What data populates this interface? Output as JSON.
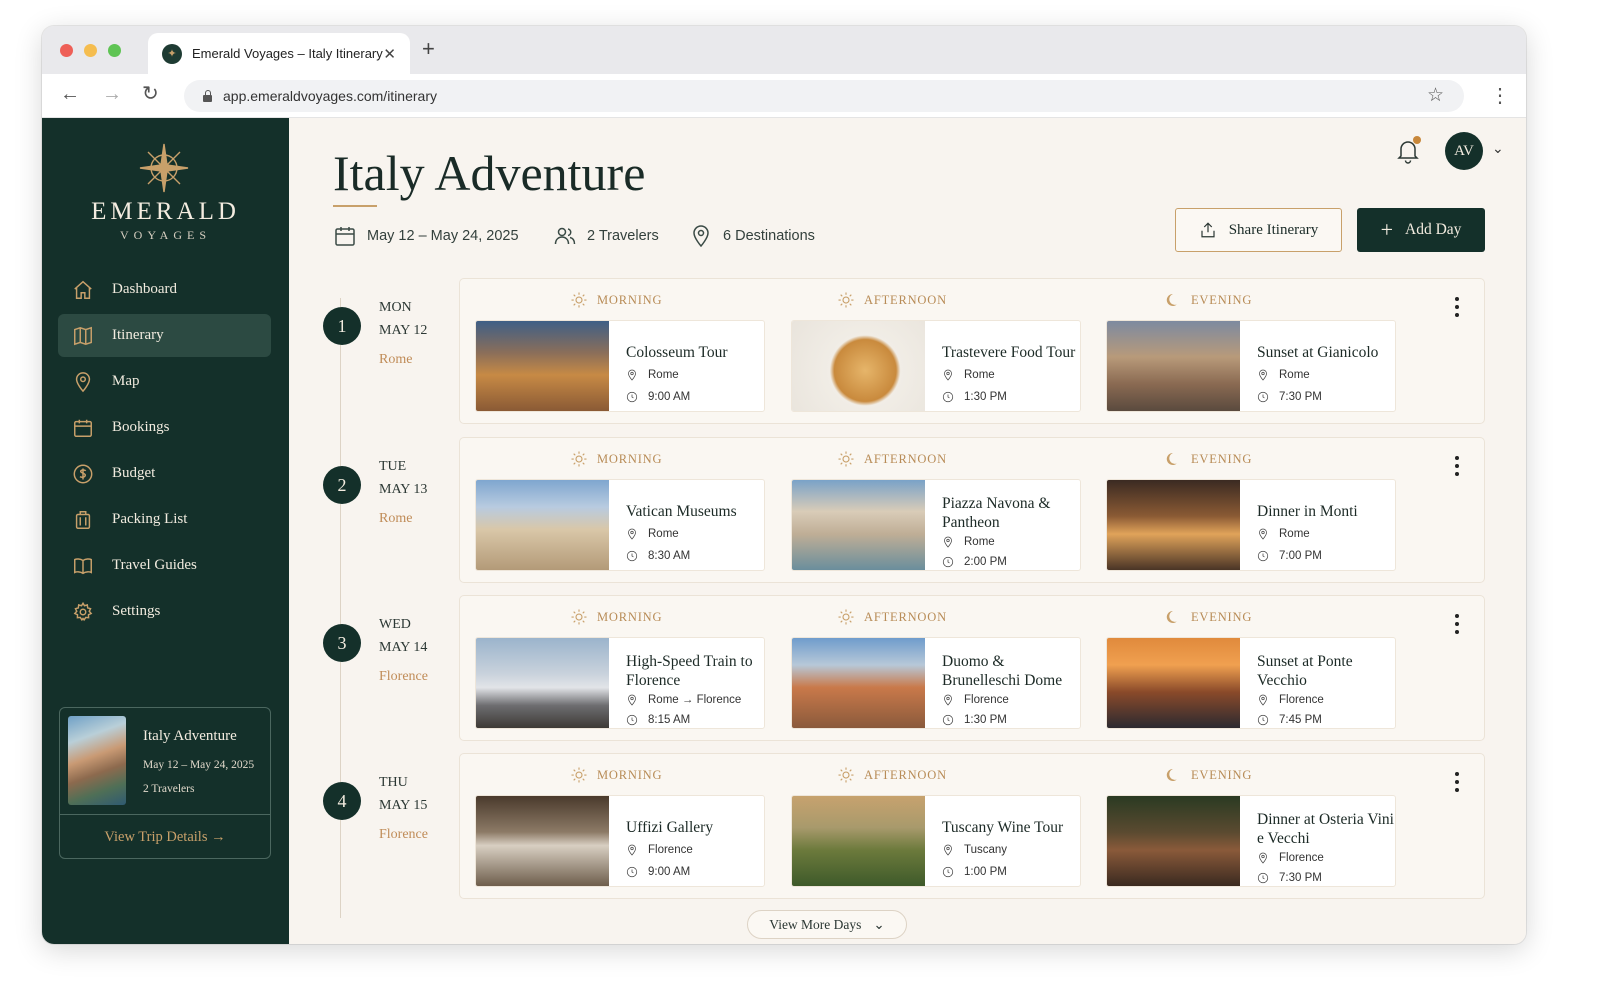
{
  "browser": {
    "tab_title": "Emerald Voyages – Italy Itinerary",
    "url": "app.emeraldvoyages.com/itinerary"
  },
  "brand": {
    "name": "EMERALD",
    "sub": "VOYAGES",
    "accent": "#c8a06a",
    "dark": "#14302a"
  },
  "sidebar": {
    "items": [
      {
        "label": "Dashboard",
        "icon": "home-icon",
        "active": false
      },
      {
        "label": "Itinerary",
        "icon": "book-map-icon",
        "active": true
      },
      {
        "label": "Map",
        "icon": "map-pin-icon",
        "active": false
      },
      {
        "label": "Bookings",
        "icon": "calendar-icon",
        "active": false
      },
      {
        "label": "Budget",
        "icon": "dollar-icon",
        "active": false
      },
      {
        "label": "Packing List",
        "icon": "luggage-icon",
        "active": false
      },
      {
        "label": "Travel Guides",
        "icon": "open-book-icon",
        "active": false
      },
      {
        "label": "Settings",
        "icon": "gear-icon",
        "active": false
      }
    ],
    "trip_card": {
      "title": "Italy Adventure",
      "dates": "May 12 – May 24, 2025",
      "travelers": "2 Travelers",
      "link": "View Trip Details"
    }
  },
  "header": {
    "title": "Italy Adventure",
    "dates": "May 12 – May 24, 2025",
    "travelers": "2 Travelers",
    "destinations": "6 Destinations",
    "avatar": "AV",
    "share_label": "Share Itinerary",
    "add_label": "Add Day"
  },
  "periods": {
    "morning": "MORNING",
    "afternoon": "AFTERNOON",
    "evening": "EVENING"
  },
  "days": [
    {
      "num": "1",
      "weekday": "MON",
      "date": "MAY 12",
      "city": "Rome",
      "activities": [
        {
          "title": "Colosseum Tour",
          "location": "Rome",
          "time": "9:00 AM"
        },
        {
          "title": "Trastevere Food Tour",
          "location": "Rome",
          "time": "1:30 PM"
        },
        {
          "title": "Sunset at Gianicolo",
          "location": "Rome",
          "time": "7:30 PM"
        }
      ]
    },
    {
      "num": "2",
      "weekday": "TUE",
      "date": "MAY 13",
      "city": "Rome",
      "activities": [
        {
          "title": "Vatican Museums",
          "location": "Rome",
          "time": "8:30 AM"
        },
        {
          "title": "Piazza Navona & Pantheon",
          "location": "Rome",
          "time": "2:00 PM"
        },
        {
          "title": "Dinner in Monti",
          "location": "Rome",
          "time": "7:00 PM"
        }
      ]
    },
    {
      "num": "3",
      "weekday": "WED",
      "date": "MAY 14",
      "city": "Florence",
      "activities": [
        {
          "title": "High-Speed Train to Florence",
          "location": "Rome → Florence",
          "time": "8:15 AM"
        },
        {
          "title": "Duomo & Brunelleschi Dome",
          "location": "Florence",
          "time": "1:30 PM"
        },
        {
          "title": "Sunset at Ponte Vecchio",
          "location": "Florence",
          "time": "7:45 PM"
        }
      ]
    },
    {
      "num": "4",
      "weekday": "THU",
      "date": "MAY 15",
      "city": "Florence",
      "activities": [
        {
          "title": "Uffizi Gallery",
          "location": "Florence",
          "time": "9:00 AM"
        },
        {
          "title": "Tuscany Wine Tour",
          "location": "Tuscany",
          "time": "1:00 PM"
        },
        {
          "title": "Dinner at Osteria Vini e Vecchi",
          "location": "Florence",
          "time": "7:30 PM"
        }
      ]
    }
  ],
  "more_label": "View More Days"
}
